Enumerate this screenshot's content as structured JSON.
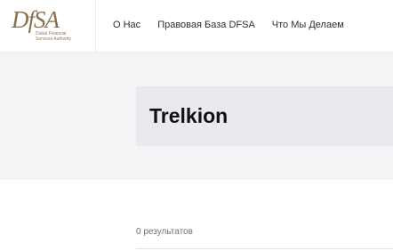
{
  "logo": {
    "main": "DfSA",
    "subtitle": "Dubai Financial Services Authority"
  },
  "nav": {
    "items": [
      {
        "label": "О Нас"
      },
      {
        "label": "Правовая База DFSA"
      },
      {
        "label": "Что Мы Делаем"
      }
    ]
  },
  "page": {
    "title": "Trelkion"
  },
  "results": {
    "summary": "0 результатов"
  }
}
